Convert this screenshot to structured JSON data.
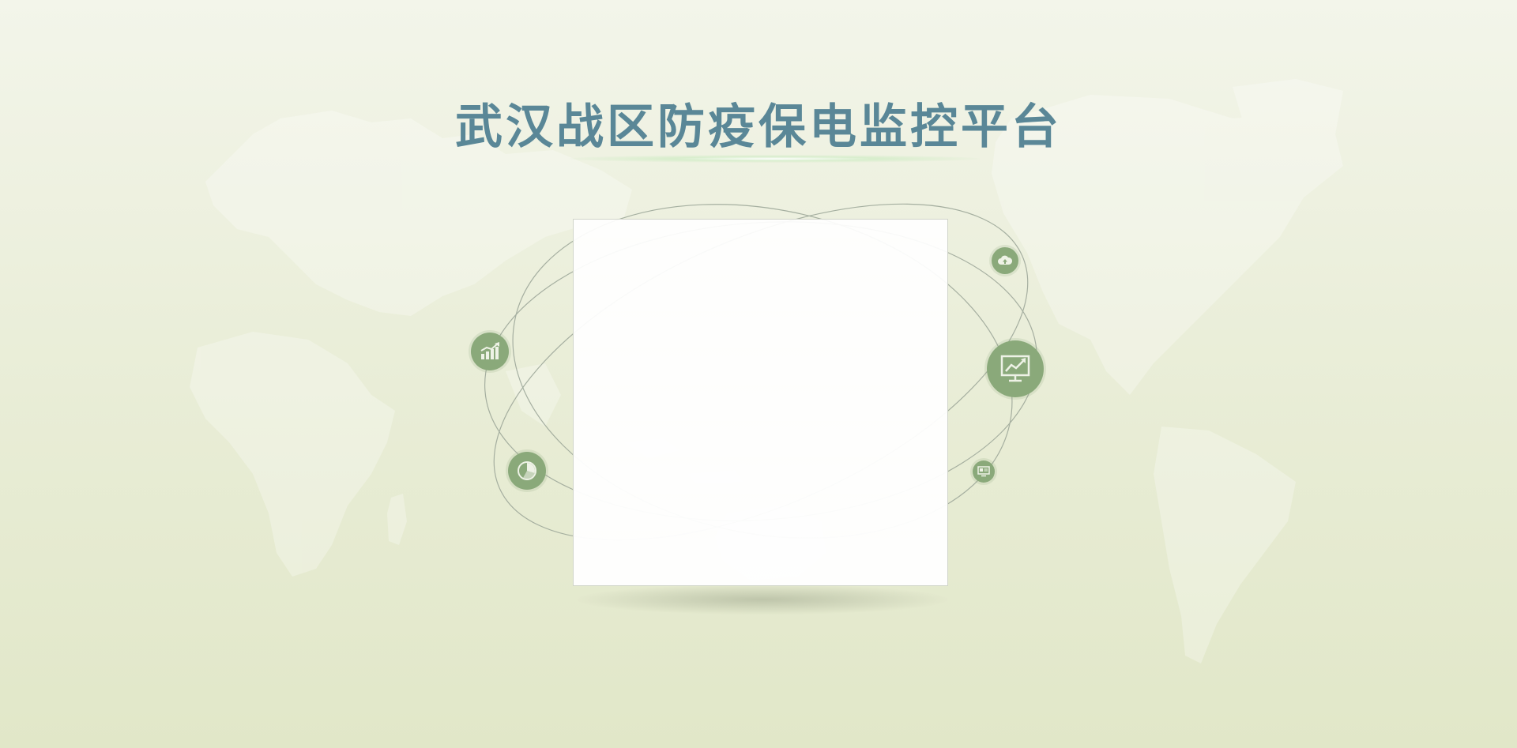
{
  "page": {
    "title": "武汉战区防疫保电监控平台"
  },
  "colors": {
    "background_top": "#f3f5ea",
    "background_bottom": "#e1e7c8",
    "title": "#5a8797",
    "node": "#8aa97a",
    "orbit": "#9ea89a"
  },
  "icons": {
    "growth": "bar-chart-growth-icon",
    "pie": "pie-chart-icon",
    "cloud": "cloud-upload-icon",
    "monitor": "monitor-trend-icon",
    "screen": "small-screen-icon"
  }
}
